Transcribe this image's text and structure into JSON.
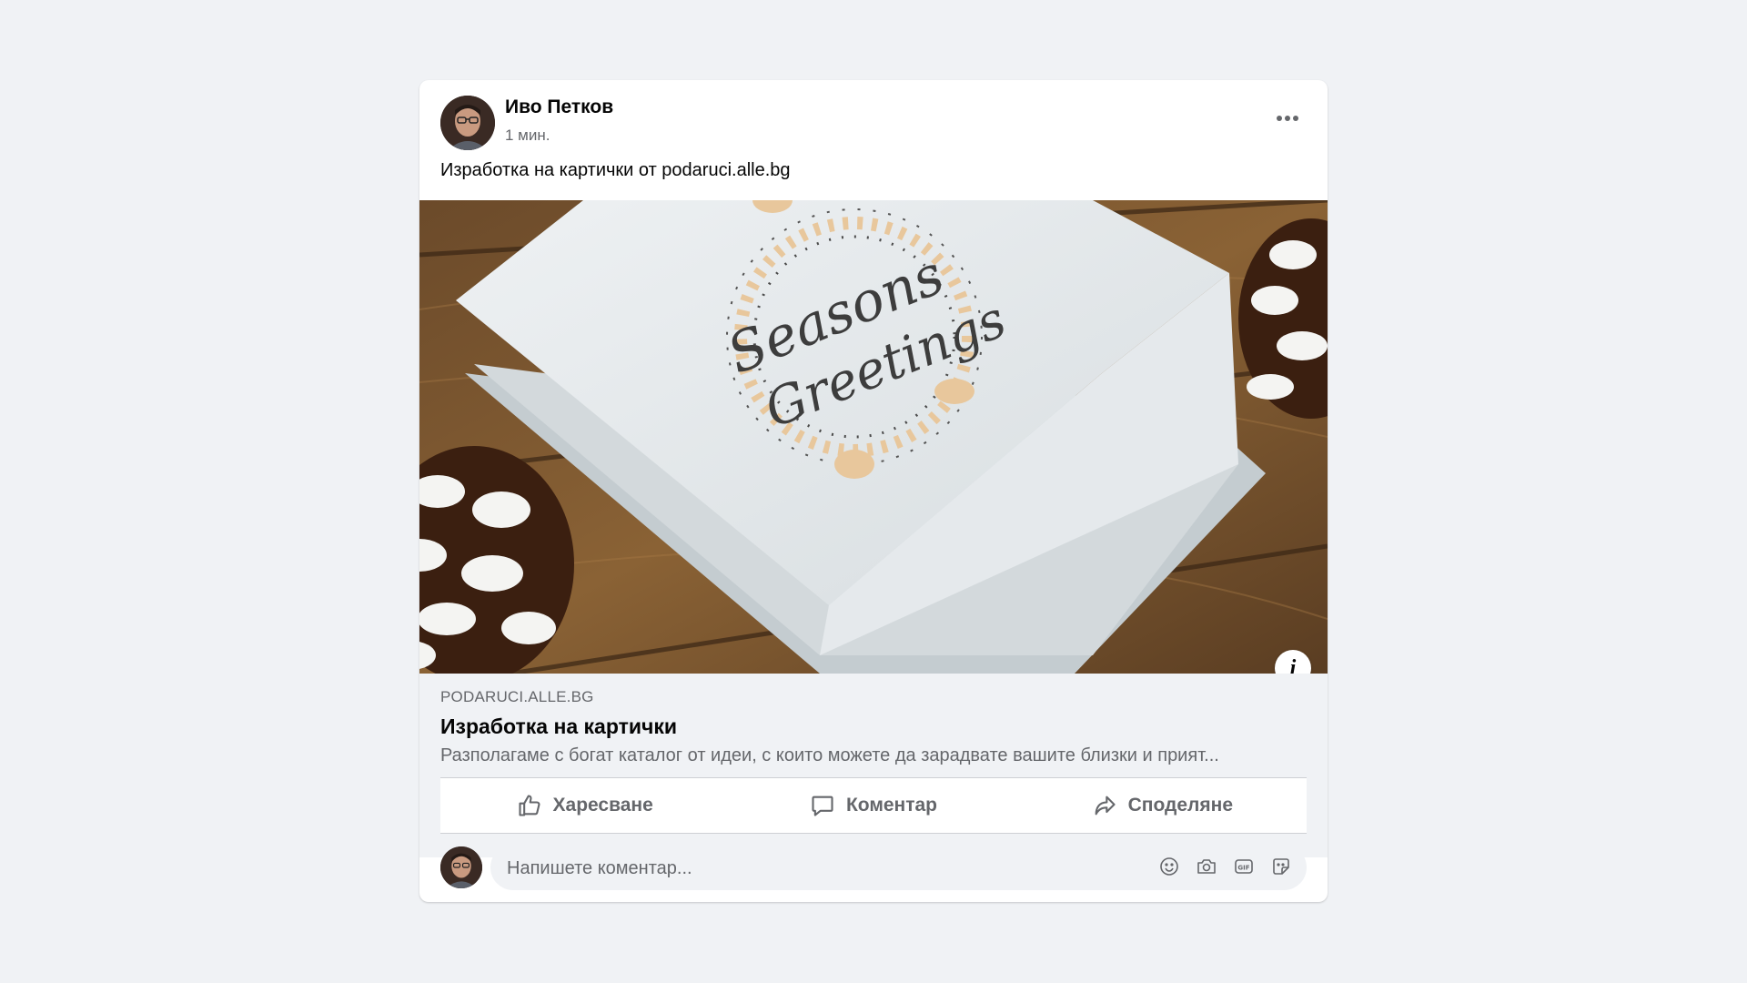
{
  "post": {
    "author": "Иво Петков",
    "time": "1 мин.",
    "text": "Изработка на картички от podaruci.alle.bg",
    "image_alt": "Seasons Greetings",
    "link": {
      "domain": "PODARUCI.ALLE.BG",
      "title": "Изработка на картички",
      "description": "Разполагаме с богат каталог от идеи, с които можете да зарадвате вашите близки и прият..."
    },
    "actions": {
      "like": "Харесване",
      "comment": "Коментар",
      "share": "Споделяне"
    },
    "comment_placeholder": "Напишете коментар..."
  },
  "icons": [
    "more-icon",
    "info-icon",
    "like-icon",
    "comment-icon",
    "share-icon",
    "emoji-icon",
    "camera-icon",
    "gif-icon",
    "sticker-icon"
  ],
  "colors": {
    "background": "#f0f2f5",
    "secondary_text": "#65676b",
    "primary_text": "#050505"
  }
}
